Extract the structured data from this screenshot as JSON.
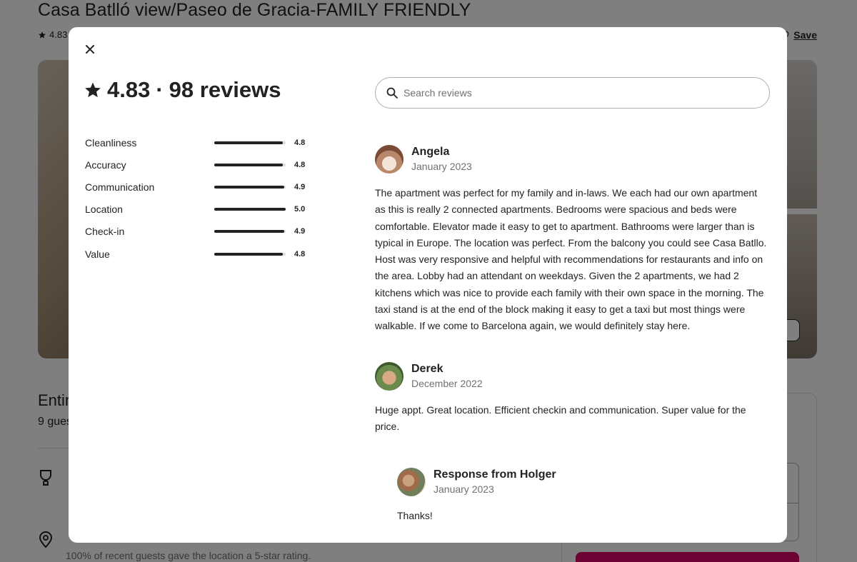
{
  "listing": {
    "title": "Casa Batlló view/Paseo de Gracia-FAMILY FRIENDLY",
    "rating_short": "4.83",
    "save_label": "Save",
    "type_heading": "Entir",
    "guests_text": "9 gues",
    "location_feature_text": "100% of recent guests gave the location a 5-star rating."
  },
  "modal": {
    "rating": "4.83",
    "separator": "·",
    "reviews_count_label": "98 reviews",
    "search_placeholder": "Search reviews",
    "categories": [
      {
        "label": "Cleanliness",
        "score": "4.8",
        "value": 4.8
      },
      {
        "label": "Accuracy",
        "score": "4.8",
        "value": 4.8
      },
      {
        "label": "Communication",
        "score": "4.9",
        "value": 4.9
      },
      {
        "label": "Location",
        "score": "5.0",
        "value": 5.0
      },
      {
        "label": "Check-in",
        "score": "4.9",
        "value": 4.9
      },
      {
        "label": "Value",
        "score": "4.8",
        "value": 4.8
      }
    ],
    "reviews": [
      {
        "name": "Angela",
        "date": "January 2023",
        "text": "The apartment was perfect for my family and in-laws. We each had our own apartment as this is really 2 connected apartments. Bedrooms were spacious and beds were comfortable. Elevator made it easy to get to apartment. Bathrooms were larger than is typical in Europe. The location was perfect. From the balcony you could see Casa Batllo. Host was very responsive and helpful with recommendations for restaurants and info on the area. Lobby had an attendant on weekdays. Given the 2 apartments, we had 2 kitchens which was nice to provide each family with their own space in the morning. The taxi stand is at the end of the block making it easy to get a taxi but most things were walkable. If we come to Barcelona again, we would definitely stay here."
      },
      {
        "name": "Derek",
        "date": "December 2022",
        "text": "Huge appt. Great location. Efficient checkin and communication. Super value for the price."
      }
    ],
    "response": {
      "title": "Response from Holger",
      "date": "January 2023",
      "text": "Thanks!"
    }
  },
  "colors": {
    "brand": "#d70466",
    "text": "#222222",
    "muted": "#717171"
  }
}
